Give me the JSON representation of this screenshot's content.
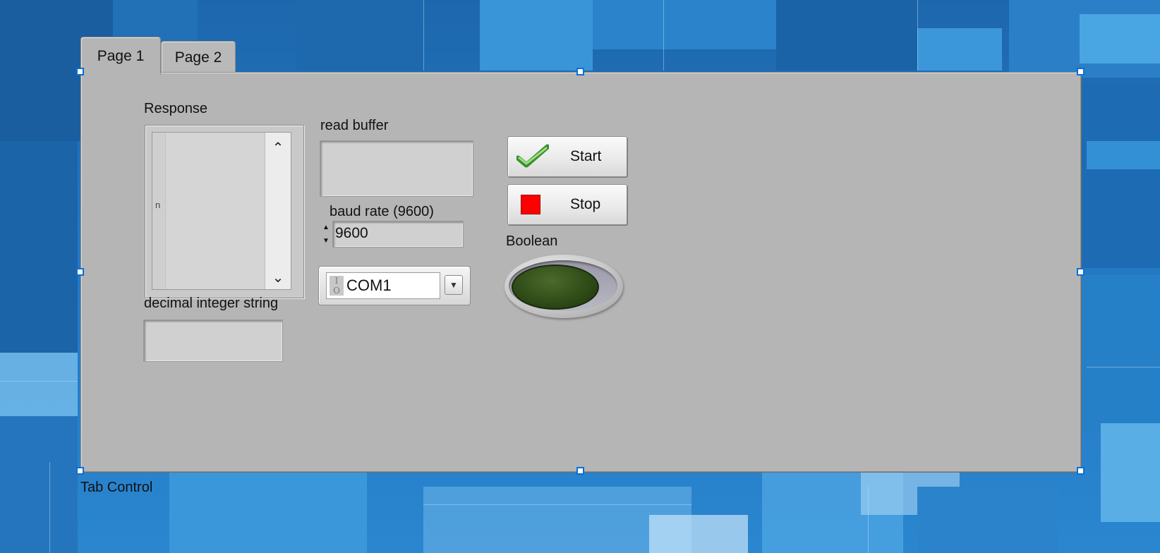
{
  "tabs": [
    {
      "label": "Page 1",
      "active": true
    },
    {
      "label": "Page 2",
      "active": false
    }
  ],
  "tab_control_caption": "Tab Control",
  "controls": {
    "response": {
      "label": "Response",
      "index_mark": "n"
    },
    "decimal_integer_string": {
      "label": "decimal integer string",
      "value": ""
    },
    "read_buffer": {
      "label": "read buffer",
      "value": ""
    },
    "baud_rate": {
      "label": "baud rate (9600)",
      "value": "9600"
    },
    "serial_port": {
      "value": "COM1",
      "io_icon": "I/O"
    },
    "start_button": {
      "label": "Start",
      "icon": "checkmark-icon"
    },
    "stop_button": {
      "label": "Stop",
      "icon": "stop-square-icon",
      "icon_color": "#ff0000"
    },
    "boolean": {
      "label": "Boolean",
      "state": "off",
      "led_color": "#2e4a16"
    }
  },
  "colors": {
    "panel": "#b5b5b5",
    "selection_handle": "#0a6fd6",
    "background": "#1f6fb5"
  }
}
